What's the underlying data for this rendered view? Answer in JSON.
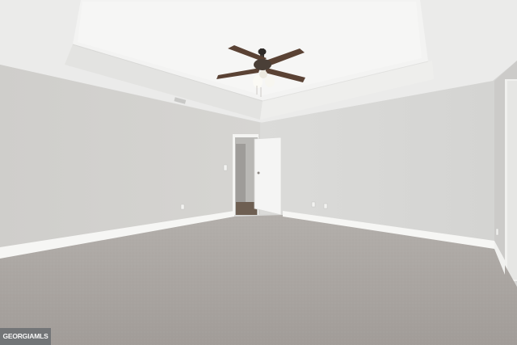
{
  "scene": {
    "description_free": true,
    "colors": {
      "ceiling": "#efefed",
      "tray_ceiling": "#f4f4f3",
      "left_wall": "#d2d1ce",
      "back_wall": "#d7d7d5",
      "right_wall": "#cfcecc",
      "carpet": "#aaa5a1",
      "baseboard": "#f5f5f3",
      "door": "#f3f3f2",
      "fan_blade": "#5a4234",
      "fan_light": "#fbfaf5"
    }
  },
  "watermark": {
    "text": "GEORGIAMLS"
  }
}
